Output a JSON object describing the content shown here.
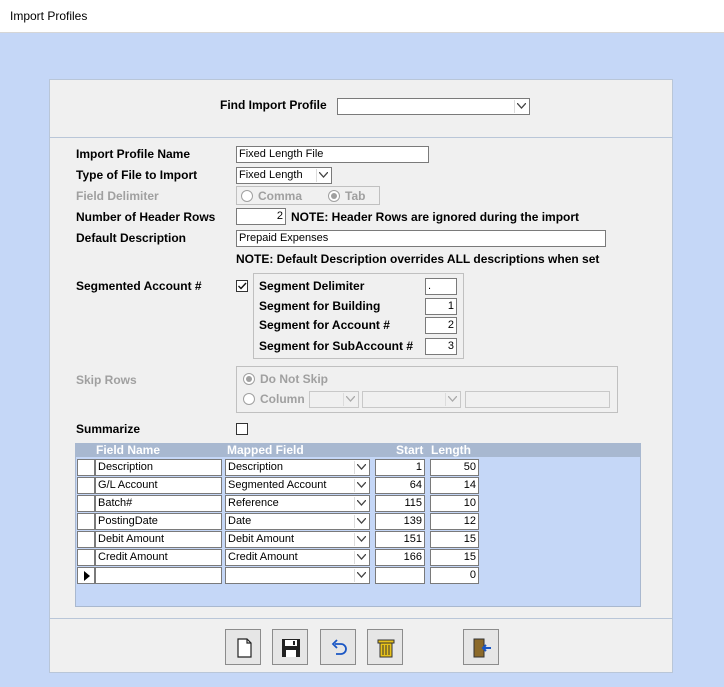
{
  "window": {
    "title": "Import Profiles"
  },
  "find": {
    "label": "Find Import Profile",
    "value": ""
  },
  "form": {
    "profile_name_label": "Import Profile Name",
    "profile_name": "Fixed Length File",
    "file_type_label": "Type of File to Import",
    "file_type": "Fixed Length",
    "delimiter_label": "Field Delimiter",
    "delimiter_options": [
      "Comma",
      "Tab"
    ],
    "delimiter_selected": "Tab",
    "header_rows_label": "Number of Header Rows",
    "header_rows": "2",
    "header_rows_note": "NOTE: Header Rows are ignored during the import",
    "default_desc_label": "Default Description",
    "default_desc": "Prepaid Expenses",
    "default_desc_note": "NOTE: Default Description overrides ALL descriptions when set",
    "segmented_label": "Segmented Account #",
    "segmented_checked": true,
    "segment_delimiter_label": "Segment Delimiter",
    "segment_delimiter": ".",
    "segment_building_label": "Segment for Building",
    "segment_building": "1",
    "segment_account_label": "Segment for Account #",
    "segment_account": "2",
    "segment_subaccount_label": "Segment for SubAccount #",
    "segment_subaccount": "3",
    "skip_rows_label": "Skip Rows",
    "skip_do_not": "Do Not Skip",
    "skip_column": "Column",
    "summarize_label": "Summarize",
    "summarize_checked": false
  },
  "grid": {
    "headers": [
      "Field Name",
      "Mapped Field",
      "Start",
      "Length"
    ],
    "rows": [
      {
        "field": "Description",
        "mapped": "Description",
        "start": "1",
        "length": "50"
      },
      {
        "field": "G/L Account",
        "mapped": "Segmented Account",
        "start": "64",
        "length": "14"
      },
      {
        "field": "Batch#",
        "mapped": "Reference",
        "start": "115",
        "length": "10"
      },
      {
        "field": "PostingDate",
        "mapped": "Date",
        "start": "139",
        "length": "12"
      },
      {
        "field": "Debit Amount",
        "mapped": "Debit Amount",
        "start": "151",
        "length": "15"
      },
      {
        "field": "Credit Amount",
        "mapped": "Credit Amount",
        "start": "166",
        "length": "15"
      }
    ],
    "new_row": {
      "field": "",
      "mapped": "",
      "start": "",
      "length": "0"
    }
  },
  "toolbar": {
    "buttons": [
      "new-document-icon",
      "save-icon",
      "undo-icon",
      "delete-trash-icon",
      "exit-door-icon"
    ]
  },
  "colors": {
    "window_bg": "#c5d7f7",
    "panel_bg": "#f0f0f0",
    "grid_header": "#a8b8d0",
    "undo_blue": "#1a56c4",
    "trash_yellow": "#e8c21a"
  }
}
